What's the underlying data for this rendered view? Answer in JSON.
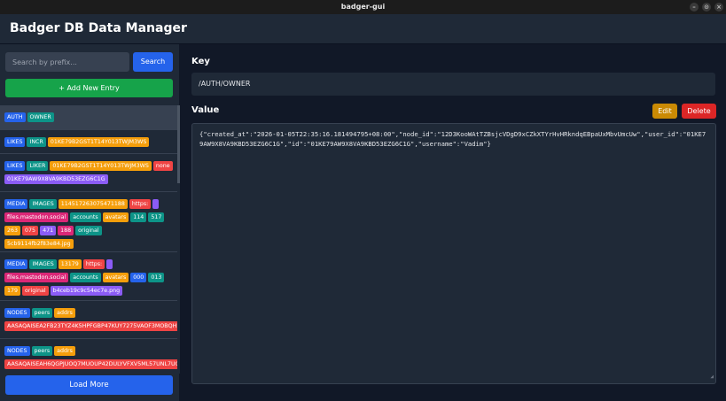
{
  "window": {
    "title": "badger-gui",
    "controls": [
      "–",
      "⊙",
      "×"
    ]
  },
  "header": {
    "title": "Badger DB Data Manager"
  },
  "sidebar": {
    "search_placeholder": "Search by prefix...",
    "search_button": "Search",
    "add_button": "+ Add New Entry",
    "load_more_button": "Load More",
    "entries": [
      {
        "selected": true,
        "rows": [
          [
            [
              "AUTH",
              "blue"
            ],
            [
              "OWNER",
              "teal"
            ]
          ]
        ]
      },
      {
        "selected": false,
        "rows": [
          [
            [
              "LIKES",
              "blue"
            ],
            [
              "INCR",
              "teal"
            ],
            [
              "01KE79B2GST1T14Y013TWJM3WS",
              "orange"
            ]
          ]
        ]
      },
      {
        "selected": false,
        "rows": [
          [
            [
              "LIKES",
              "blue"
            ],
            [
              "LIKER",
              "teal"
            ],
            [
              "01KE79B2GST1T14Y013TWJM3WS",
              "orange"
            ],
            [
              "none",
              "red"
            ]
          ],
          [
            [
              "01KE79AW9X8VA9KBD53EZG6C1G",
              "purple"
            ]
          ]
        ]
      },
      {
        "selected": false,
        "rows": [
          [
            [
              "MEDIA",
              "blue"
            ],
            [
              "IMAGES",
              "teal"
            ],
            [
              "114517263075471188",
              "orange"
            ],
            [
              "https:",
              "red"
            ],
            [
              "",
              "purple"
            ]
          ],
          [
            [
              "files.mastodon.social",
              "pink"
            ],
            [
              "accounts",
              "teal"
            ],
            [
              "avatars",
              "orange"
            ],
            [
              "114",
              "teal"
            ],
            [
              "517",
              "teal"
            ]
          ],
          [
            [
              "263",
              "orange"
            ],
            [
              "075",
              "red"
            ],
            [
              "471",
              "purple"
            ],
            [
              "188",
              "pink"
            ],
            [
              "original",
              "teal"
            ]
          ],
          [
            [
              "5cb9114fb2f83e84.jpg",
              "orange"
            ]
          ]
        ]
      },
      {
        "selected": false,
        "rows": [
          [
            [
              "MEDIA",
              "blue"
            ],
            [
              "IMAGES",
              "teal"
            ],
            [
              "13179",
              "orange"
            ],
            [
              "https:",
              "red"
            ],
            [
              "",
              "purple"
            ]
          ],
          [
            [
              "files.mastodon.social",
              "pink"
            ],
            [
              "accounts",
              "teal"
            ],
            [
              "avatars",
              "orange"
            ],
            [
              "000",
              "blue"
            ],
            [
              "013",
              "teal"
            ]
          ],
          [
            [
              "179",
              "orange"
            ],
            [
              "original",
              "red"
            ],
            [
              "b4ceb19c9c54ec7e.png",
              "purple"
            ]
          ]
        ]
      },
      {
        "selected": false,
        "rows": [
          [
            [
              "NODES",
              "blue"
            ],
            [
              "peers",
              "teal"
            ],
            [
              "addrs",
              "orange"
            ]
          ],
          [
            [
              "AASAQAISEA2FB23TYZ4K5HPFGBP47KUY7275VAOF3MOBQH5TJM",
              "red"
            ]
          ]
        ]
      },
      {
        "selected": false,
        "rows": [
          [
            [
              "NODES",
              "blue"
            ],
            [
              "peers",
              "teal"
            ],
            [
              "addrs",
              "orange"
            ]
          ],
          [
            [
              "AASAQAISEAH6QGPJUOQ7MUOUP42DULYVFXV5ML57UNL7UCGI",
              "red"
            ]
          ]
        ]
      }
    ]
  },
  "main": {
    "key_label": "Key",
    "key_value": "/AUTH/OWNER",
    "value_label": "Value",
    "edit_button": "Edit",
    "delete_button": "Delete",
    "value_text": "{\"created_at\":\"2026-01-05T22:35:16.181494795+08:00\",\"node_id\":\"12D3KooWAtTZBsjcVDgD9xCZkXTYrHvHRkndqEBpaUxMbvUmcUw\",\"user_id\":\"01KE79AW9X8VA9KBD53EZG6C1G\",\"id\":\"01KE79AW9X8VA9KBD53EZG6C1G\",\"username\":\"Vadim\"}"
  },
  "colors": {
    "blue": "#2563eb",
    "teal": "#0d9488",
    "orange": "#f59e0b",
    "red": "#ef4444",
    "purple": "#8b5cf6",
    "pink": "#db2777"
  }
}
